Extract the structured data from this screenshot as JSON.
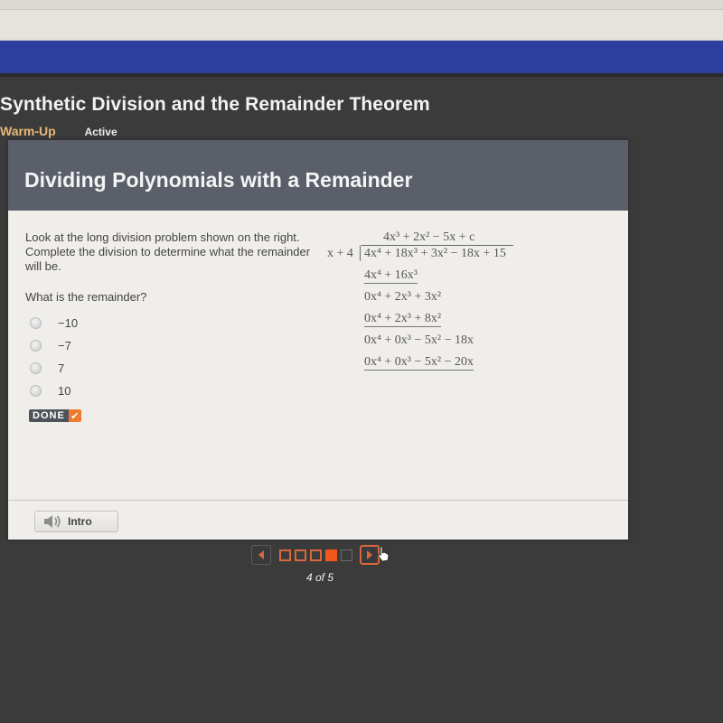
{
  "course": {
    "title": "Synthetic Division and the Remainder Theorem",
    "section": "Warm-Up",
    "status": "Active"
  },
  "card": {
    "title": "Dividing Polynomials with a Remainder",
    "prompt": "Look at the long division problem shown on the right. Complete the division to determine what the remainder will be.",
    "question": "What is the remainder?",
    "options": [
      {
        "label": "−10",
        "selected": false
      },
      {
        "label": "−7",
        "selected": false
      },
      {
        "label": "7",
        "selected": false
      },
      {
        "label": "10",
        "selected": false
      }
    ],
    "done_label": "DONE",
    "done_icon": "checkmark-icon",
    "intro_label": "Intro",
    "intro_icon": "speaker-icon"
  },
  "long_division": {
    "quotient": [
      "4x³",
      "+ 2x²",
      "− 5x",
      "+ c"
    ],
    "divisor": "x + 4",
    "dividend": "4x⁴ + 18x³ + 3x² − 18x + 15",
    "steps": [
      {
        "text": "4x⁴ + 16x³",
        "underlined": true
      },
      {
        "text": "0x⁴ + 2x³ + 3x²",
        "underlined": false
      },
      {
        "text": "0x⁴ + 2x³ + 8x²",
        "underlined": true
      },
      {
        "text": "0x⁴ + 0x³ − 5x² − 18x",
        "underlined": false
      },
      {
        "text": "0x⁴ + 0x³ − 5x² − 20x",
        "underlined": true
      }
    ]
  },
  "pager": {
    "current": 4,
    "total": 5,
    "label": "4 of 5",
    "pages": [
      {
        "state": "visited"
      },
      {
        "state": "visited"
      },
      {
        "state": "visited"
      },
      {
        "state": "current"
      },
      {
        "state": "locked"
      }
    ],
    "prev_icon": "arrow-left-icon",
    "next_icon": "arrow-right-icon"
  },
  "colors": {
    "accent": "#f0571c",
    "section": "#e8b874",
    "header_bg": "#5a5f6a",
    "brand_band": "#2c3f9e"
  }
}
